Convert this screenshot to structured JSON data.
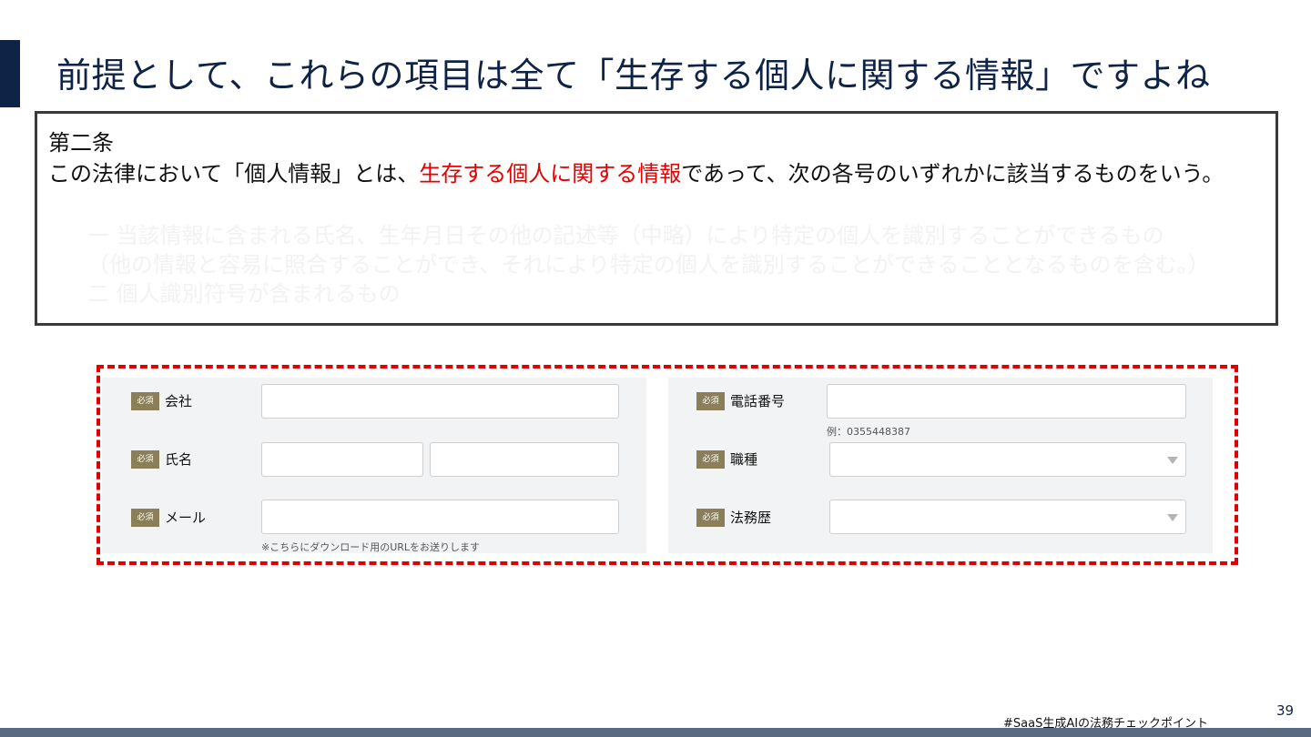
{
  "slide": {
    "title": "前提として、これらの項目は全て「生存する個人に関する情報」ですよね",
    "page_number": "39",
    "footer_tag": "#SaaS生成AIの法務チェックポイント"
  },
  "law": {
    "article": "第二条",
    "text_before": "この法律において「個人情報」とは、",
    "text_highlight": "生存する個人に関する情報",
    "text_after": "であって、次の各号のいずれかに該当するものをいう。",
    "faded_lines": [
      "一 当該情報に含まれる氏名、生年月日その他の記述等（中略）により特定の個人を識別することができるもの",
      "（他の情報と容易に照合することができ、それにより特定の個人を識別することができることとなるものを含む。）",
      "二 個人識別符号が含まれるもの"
    ]
  },
  "form": {
    "required_badge": "必須",
    "left": {
      "company_label": "会社",
      "name_label": "氏名",
      "email_label": "メール",
      "email_hint": "※こちらにダウンロード用のURLをお送りします"
    },
    "right": {
      "phone_label": "電話番号",
      "phone_hint": "例：0355448387",
      "job_label": "職種",
      "legal_exp_label": "法務歴"
    }
  },
  "colors": {
    "title": "#0f2347",
    "highlight": "#e60000",
    "dashed_border": "#e00000",
    "badge": "#8a7f58",
    "panel": "#f2f3f5"
  }
}
